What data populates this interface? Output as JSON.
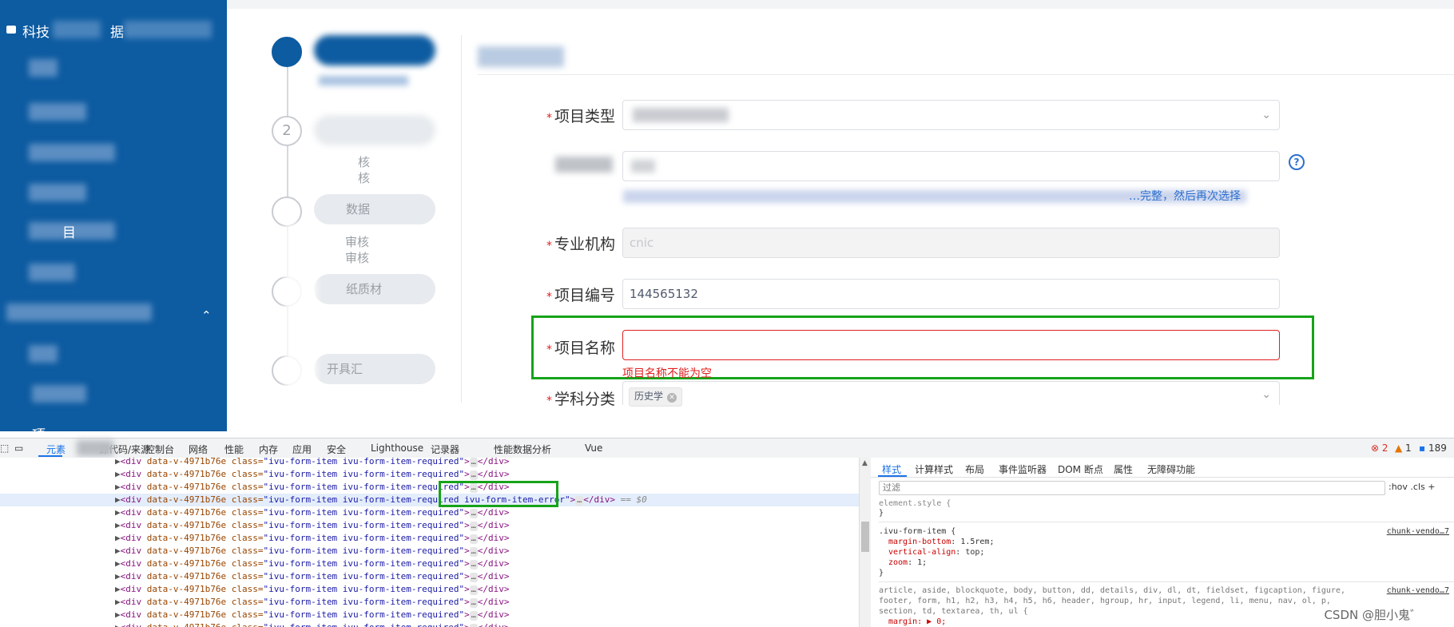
{
  "sidebar": {
    "header_text": "科技",
    "header_text2": "据",
    "items": [
      "",
      "",
      "",
      "",
      "",
      "目",
      ""
    ],
    "group_item": "",
    "sub_items": [
      "",
      "",
      "项"
    ]
  },
  "steps": [
    {
      "num": "",
      "label": "",
      "sub": []
    },
    {
      "num": "2",
      "label": "",
      "sub": [
        "核",
        "核"
      ]
    },
    {
      "num": "",
      "label": "数据",
      "sub": [
        "审核",
        "审核"
      ]
    },
    {
      "num": "",
      "label": "纸质材",
      "sub": []
    },
    {
      "num": "",
      "label": "开具汇",
      "sub": []
    }
  ],
  "form": {
    "fields": [
      {
        "label": "项目类型",
        "value": "",
        "type": "select"
      },
      {
        "label": "",
        "value": "",
        "type": "input"
      },
      {
        "label": "专业机构",
        "value": "cnic",
        "type": "disabled"
      },
      {
        "label": "项目编号",
        "value": "144565132",
        "type": "input"
      },
      {
        "label": "项目名称",
        "value": "",
        "type": "error"
      },
      {
        "label": "学科分类",
        "value": "",
        "type": "select"
      }
    ],
    "hint_text": "…完整，然后再次选择",
    "error_message": "项目名称不能为空",
    "tag": "历史学",
    "help_glyph": "?"
  },
  "devtools": {
    "tabs": [
      "元素",
      "源代码/来源",
      "控制台",
      "网络",
      "性能",
      "内存",
      "应用",
      "安全",
      "Lighthouse",
      "记录器",
      "性能数据分析",
      "Vue"
    ],
    "status": {
      "errors": "2",
      "warnings": "1",
      "messages": "189"
    },
    "elements": {
      "attr_prefix": "data-v-4971b76e",
      "class_name": "class",
      "class_value": "ivu-form-item ivu-form-item-required",
      "selected_extra": " ivu-form-item-error",
      "eq_sel": "== $0",
      "tag_open": "<div",
      "tag_close": "</div>"
    },
    "styles": {
      "tabs": [
        "样式",
        "计算样式",
        "布局",
        "事件监听器",
        "DOM 断点",
        "属性",
        "无障碍功能"
      ],
      "filter_placeholder": "过滤",
      "filter_buttons": ":hov  .cls  +",
      "element_style": "element.style {",
      "rule_selector": ".ivu-form-item {",
      "rule_props": [
        {
          "name": "margin-bottom",
          "value": "1.5rem;"
        },
        {
          "name": "vertical-align",
          "value": "top;"
        },
        {
          "name": "zoom",
          "value": "1;"
        }
      ],
      "rule_source": "chunk-vendo…7",
      "reset_selector_1": "article, aside, blockquote, body, button, dd, details, div, dl, dt, fieldset, figcaption, figure,",
      "reset_selector_2": "footer, form, h1, h2, h3, h4, h5, h6, header, hgroup, hr, input, legend, li, menu, nav, ol, p,",
      "reset_selector_3": "section, td, textarea, th, ul {",
      "reset_prop": "margin: ▶ 0;",
      "reset_source": "chunk-vendo…7",
      "close_brace": "}"
    }
  },
  "watermark": "CSDN @胆小鬼゛"
}
